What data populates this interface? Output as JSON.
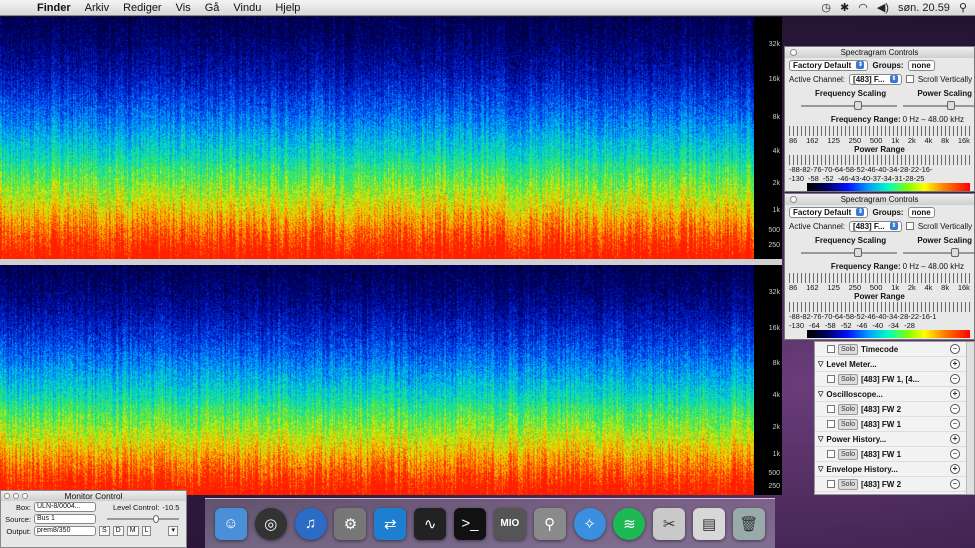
{
  "menubar": {
    "app": "Finder",
    "items": [
      "Arkiv",
      "Rediger",
      "Vis",
      "Gå",
      "Vindu",
      "Hjelp"
    ],
    "clock": "søn. 20.59"
  },
  "spectrogram": {
    "freq_labels": [
      "32k",
      "16k",
      "8k",
      "4k",
      "2k",
      "1k",
      "500",
      "250"
    ]
  },
  "sc1": {
    "title": "Spectragram Controls",
    "preset": "Factory Default",
    "groups_label": "Groups:",
    "groups_value": "none",
    "channel_label": "Active Channel:",
    "channel_value": "[483] F...",
    "scroll_label": "Scroll Vertically",
    "freq_scaling": "Frequency Scaling",
    "power_scaling": "Power Scaling",
    "freq_range_label": "Frequency Range:",
    "freq_range_value": "0 Hz – 48.00 kHz",
    "freq_ticks": [
      "86",
      "162",
      "125",
      "250",
      "500",
      "1k",
      "2k",
      "4k",
      "8k",
      "16k"
    ],
    "power_range": "Power Range",
    "power_ticks": "-88-82-76-70-64-58-52-46-40-34-28-22-16-",
    "power_scale": [
      "-130",
      "-58",
      "-52",
      "-46-43-40-37-34-31-28-25"
    ]
  },
  "sc2": {
    "title": "Spectragram Controls",
    "preset": "Factory Default",
    "groups_label": "Groups:",
    "groups_value": "none",
    "channel_label": "Active Channel:",
    "channel_value": "[483] F...",
    "scroll_label": "Scroll Vertically",
    "freq_scaling": "Frequency Scaling",
    "power_scaling": "Power Scaling",
    "freq_range_label": "Frequency Range:",
    "freq_range_value": "0 Hz – 48.00 kHz",
    "freq_ticks": [
      "86",
      "162",
      "125",
      "250",
      "500",
      "1k",
      "2k",
      "4k",
      "8k",
      "16k"
    ],
    "power_range": "Power Range",
    "power_ticks": "-88-82-76-70-64-58-52-46-40-34-28-22-16-1",
    "power_scale": [
      "-130",
      "-64",
      "-58",
      "-52",
      "-46",
      "-40",
      "-34",
      "-28"
    ]
  },
  "plist": {
    "solo": "Solo",
    "timecode": "Timecode",
    "level_meter": "Level Meter...",
    "level_meter_item": "[483] FW 1, [4...",
    "oscilloscope": "Oscilloscope...",
    "osc_item1": "[483] FW 2",
    "osc_item2": "[483] FW 1",
    "power_history": "Power History...",
    "power_item": "[483] FW 1",
    "envelope_history": "Envelope History...",
    "envelope_item": "[483] FW 2"
  },
  "monitor": {
    "title": "Monitor Control",
    "box_label": "Box:",
    "box_value": "ULN-8/0004...",
    "level_label": "Level Control:",
    "level_value": "-10.5",
    "source_label": "Source:",
    "source_value": "Bus 1",
    "output_label": "Output:",
    "output_value": "prem8/350",
    "btn_s": "S",
    "btn_d": "D",
    "btn_m": "M",
    "btn_l": "L"
  },
  "dock": {
    "mio_label": "MIO"
  }
}
